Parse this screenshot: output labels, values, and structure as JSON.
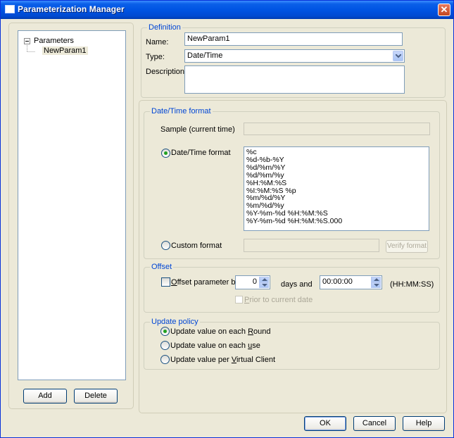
{
  "window": {
    "title": "Parameterization Manager",
    "close_glyph": "✕"
  },
  "tree": {
    "root": "Parameters",
    "child": "NewParam1"
  },
  "left_buttons": {
    "add": "Add",
    "delete": "Delete"
  },
  "definition": {
    "title": "Definition",
    "name_label": "Name:",
    "name_value": "NewParam1",
    "type_label": "Type:",
    "type_value": "Date/Time",
    "description_label": "Description",
    "description_value": ""
  },
  "datetime_format": {
    "title": "Date/Time format",
    "sample_label": "Sample (current time)",
    "sample_value": "",
    "format_radio_label": "Date/Time format",
    "format_selected": true,
    "formats": [
      "%c",
      "%d-%b-%Y",
      "%d/%m/%Y",
      "%d/%m/%y",
      "%H:%M:%S",
      "%I:%M:%S %p",
      "%m/%d/%Y",
      "%m/%d/%y",
      "%Y-%m-%d %H:%M:%S",
      "%Y-%m-%d %H:%M:%S.000"
    ],
    "custom_radio_label": "Custom format",
    "custom_value": "",
    "verify_button": "Verify format"
  },
  "offset": {
    "title": "Offset",
    "offset_check_label_first": "O",
    "offset_check_label_rest": "ffset parameter by",
    "days_value": "0",
    "days_label": "days and",
    "time_value": "00:00:00",
    "time_unit": "(HH:MM:SS)",
    "prior_label_first": "P",
    "prior_label_rest": "rior to current date"
  },
  "update_policy": {
    "title": "Update policy",
    "options": [
      {
        "pre": "Update value on each ",
        "key": "R",
        "post": "ound",
        "checked": true
      },
      {
        "pre": "Update value on each ",
        "key": "u",
        "post": "se",
        "checked": false
      },
      {
        "pre": "Update value per ",
        "key": "V",
        "post": "irtual Client",
        "checked": false
      }
    ]
  },
  "footer": {
    "ok": "OK",
    "cancel": "Cancel",
    "help": "Help"
  },
  "colors": {
    "titlebar": "#0054E3",
    "dialog_bg": "#ECE9D8",
    "group_title": "#0046D5",
    "radio_dot": "#21A121"
  }
}
